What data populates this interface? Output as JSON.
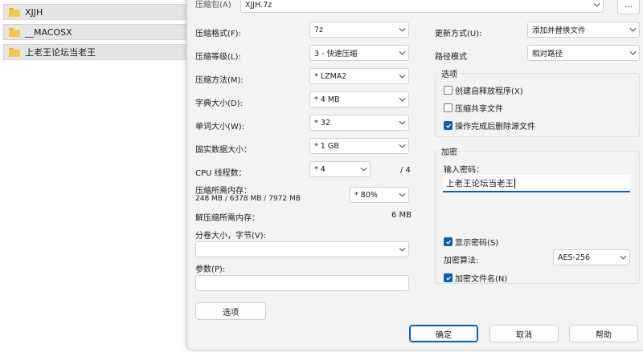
{
  "explorer": {
    "items": [
      {
        "label": "XJJH",
        "icon": "folder-icon"
      },
      {
        "label": "__MACOSX",
        "icon": "folder-icon"
      },
      {
        "label": "上老王论坛当老王",
        "icon": "folder-icon"
      }
    ]
  },
  "dialog": {
    "archive_label": "压缩包(A)",
    "archive_value": "XJJH.7z",
    "browse_label": "...",
    "left": {
      "format_label": "压缩格式(F):",
      "format_value": "7z",
      "level_label": "压缩等级(L):",
      "level_value": "3 - 快速压缩",
      "method_label": "压缩方法(M):",
      "method_value": "* LZMA2",
      "dict_label": "字典大小(D):",
      "dict_value": "* 4 MB",
      "word_label": "单词大小(W):",
      "word_value": "* 32",
      "solid_label": "固实数据大小：",
      "solid_value": "* 1 GB",
      "cpu_label": "CPU 线程数：",
      "cpu_value": "* 4",
      "cpu_total": "/ 4",
      "mem_comp_label": "压缩所需内存：",
      "mem_comp_detail": "248 MB / 6378 MB / 7972 MB",
      "mem_comp_value": "* 80%",
      "mem_decomp_label": "解压缩所需内存：",
      "mem_decomp_value": "6 MB",
      "split_label": "分卷大小，字节(V):",
      "split_value": "",
      "params_label": "参数(P):",
      "params_value": "",
      "options_button": "选项"
    },
    "right": {
      "update_label": "更新方式(U):",
      "update_value": "添加并替换文件",
      "path_label": "路径模式",
      "path_value": "相对路径",
      "options_group": "选项",
      "opt_sfx": {
        "label": "创建自释放程序(X)",
        "checked": false
      },
      "opt_shared": {
        "label": "压缩共享文件",
        "checked": false
      },
      "opt_delete": {
        "label": "操作完成后删除源文件",
        "checked": true
      },
      "encrypt_group": "加密",
      "password_label": "输入密码：",
      "password_value": "上老王论坛当老王",
      "show_password": {
        "label": "显示密码(S)",
        "checked": true
      },
      "enc_method_label": "加密算法:",
      "enc_method_value": "AES-256",
      "encrypt_names": {
        "label": "加密文件名(N)",
        "checked": true
      }
    },
    "buttons": {
      "ok": "确定",
      "cancel": "取消",
      "help": "帮助"
    }
  },
  "colors": {
    "accent": "#005fb8",
    "dialog_bg": "#f3f3f3",
    "folder": "#f5c84c"
  }
}
